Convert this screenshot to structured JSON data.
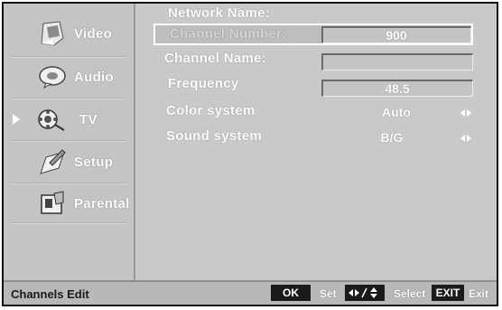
{
  "menu": {
    "items": [
      {
        "label": "Video",
        "icon": "video-icon",
        "selected": false
      },
      {
        "label": "Audio",
        "icon": "audio-icon",
        "selected": false
      },
      {
        "label": "TV",
        "icon": "tv-icon",
        "selected": true
      },
      {
        "label": "Setup",
        "icon": "setup-icon",
        "selected": false
      },
      {
        "label": "Parental",
        "icon": "parental-icon",
        "selected": false
      }
    ]
  },
  "channel_edit": {
    "network_name_label": "Network Name:",
    "channel_number_label": "Channel Number:",
    "channel_number_value": "900",
    "channel_name_label": "Channel Name:",
    "channel_name_value": "",
    "frequency_label": "Frequency",
    "frequency_value": "48.5",
    "color_system_label": "Color system",
    "color_system_value": "Auto",
    "sound_system_label": "Sound system",
    "sound_system_value": "B/G"
  },
  "footer": {
    "title": "Channels Edit",
    "ok_key": "OK",
    "ok_action": "Set",
    "nav_action": "Select",
    "exit_key": "EXIT",
    "exit_action": "Exit"
  },
  "colors": {
    "background": "#c9c9c9",
    "text": "#ffffff",
    "key_background": "#1a1a1a"
  }
}
